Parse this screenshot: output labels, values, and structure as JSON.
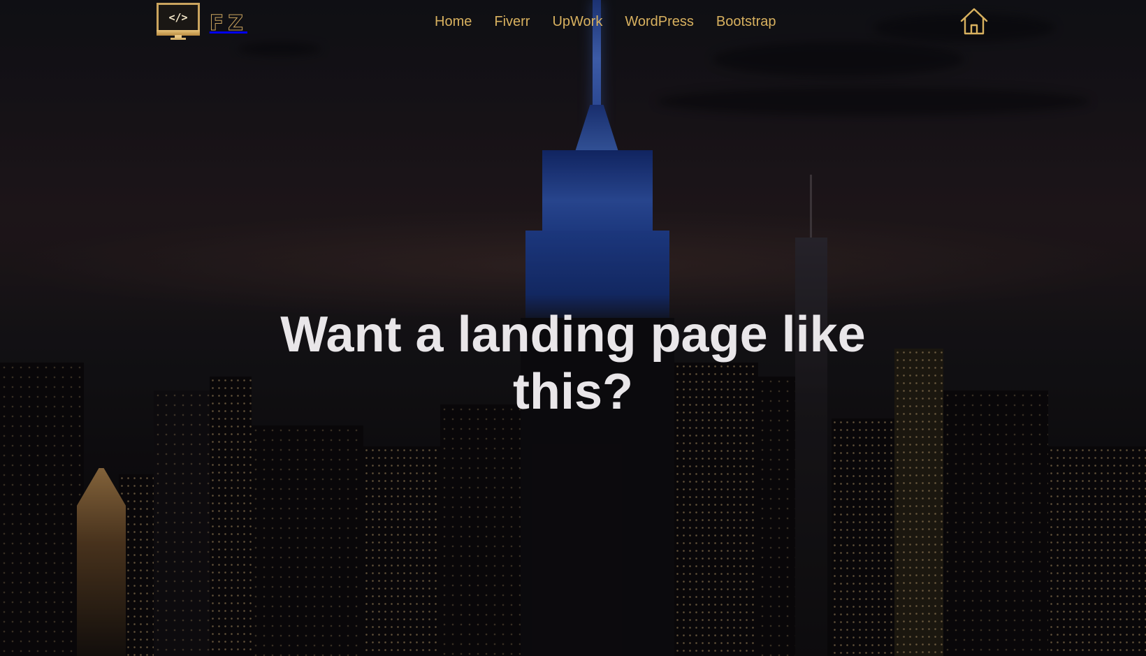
{
  "logo": {
    "screen_text": "</>",
    "letters": "FZ"
  },
  "nav": {
    "items": [
      {
        "label": "Home"
      },
      {
        "label": "Fiverr"
      },
      {
        "label": "UpWork"
      },
      {
        "label": "WordPress"
      },
      {
        "label": "Bootstrap"
      }
    ],
    "home_icon": "home-icon"
  },
  "hero": {
    "headline": "Want a landing page like this?",
    "background": "night-city-skyline"
  },
  "colors": {
    "accent_gold": "#d8b15f",
    "headline_text": "#e9e6e9",
    "building_light_blue": "#4f7fe8"
  }
}
